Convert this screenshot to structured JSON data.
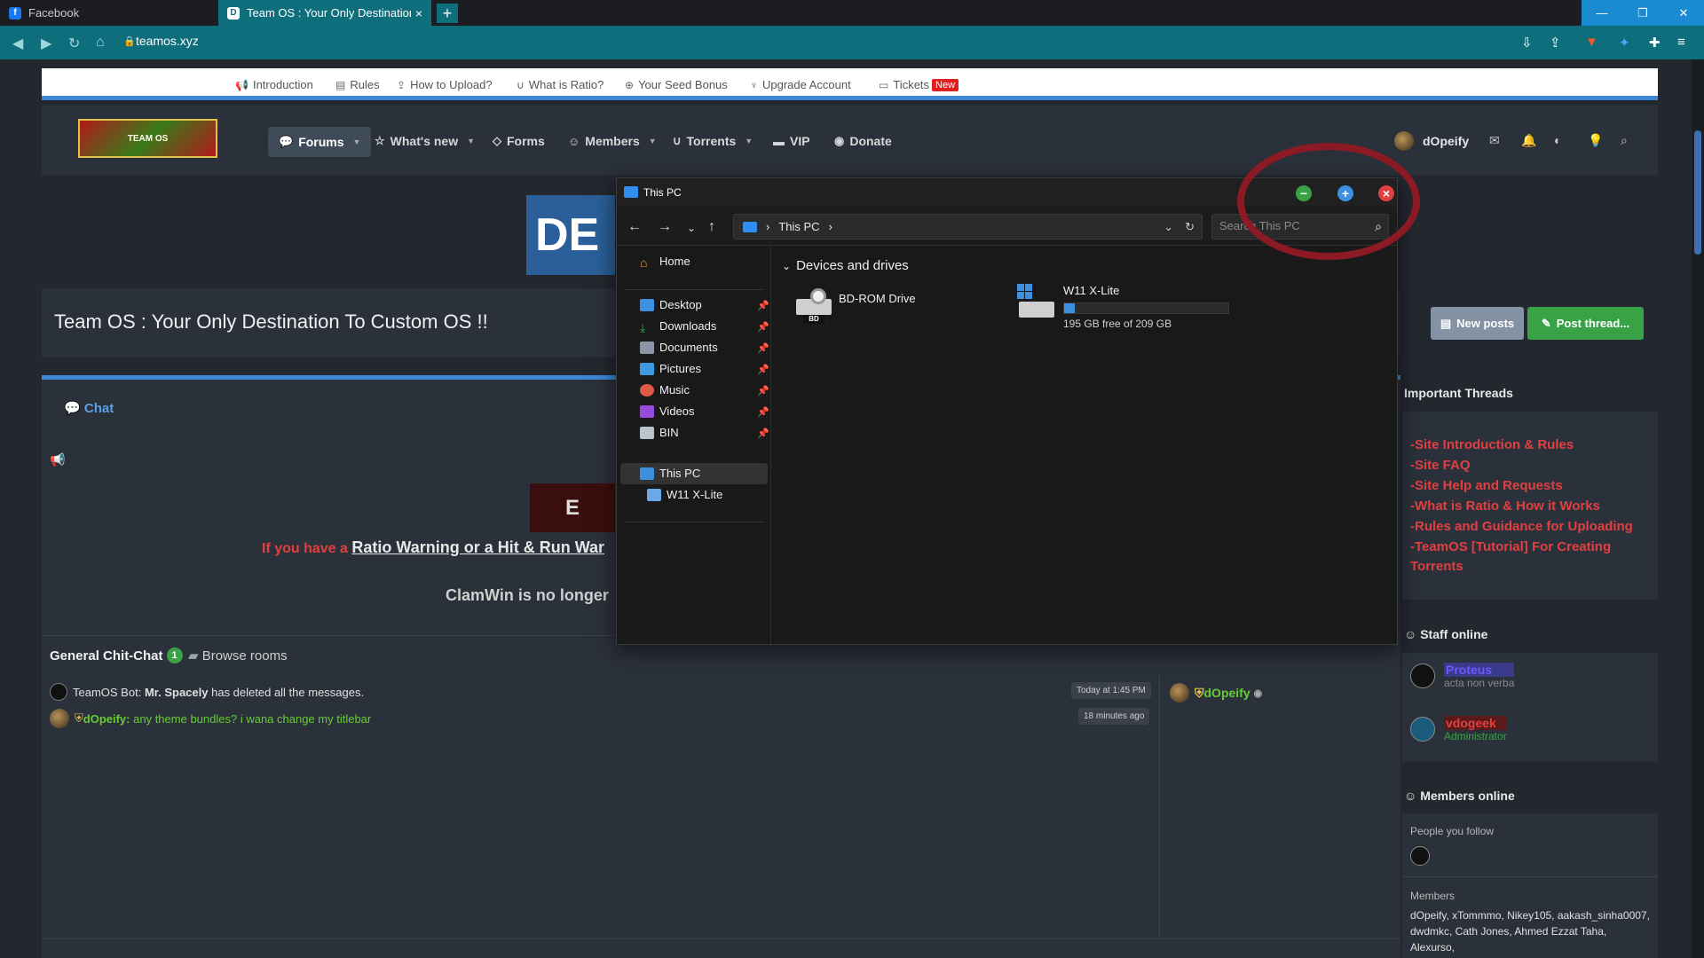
{
  "browser": {
    "tabs": [
      {
        "label": "Facebook"
      },
      {
        "label": "Team OS : Your Only Destination T"
      }
    ],
    "url": "teamos.xyz"
  },
  "site": {
    "top_links": [
      "Introduction",
      "Rules",
      "How to Upload?",
      "What is Ratio?",
      "Your Seed Bonus",
      "Upgrade Account",
      "Tickets"
    ],
    "new_badge": "New",
    "nav": [
      "Forums",
      "What's new",
      "Forms",
      "Members",
      "Torrents",
      "VIP",
      "Donate"
    ],
    "username": "dOpeify",
    "page_title": "Team OS : Your Only Destination To Custom OS !!",
    "new_posts": "New posts",
    "post_thread": "Post thread...",
    "chat_label": "Chat",
    "warn_prefix": "If you have a",
    "warn_link": "Ratio Warning or a Hit & Run War",
    "clam_text": "ClamWin is no longer",
    "room_name": "General Chit-Chat",
    "room_count": "1",
    "browse_rooms": "Browse rooms",
    "messages": [
      {
        "author": "TeamOS Bot:",
        "strong": "Mr. Spacely",
        "text": "has deleted all the messages.",
        "time": "Today at 1:45 PM"
      },
      {
        "author": "dOpeify:",
        "text": "any theme bundles? i wana change my titlebar",
        "time": "18 minutes ago"
      }
    ],
    "chat_user": "dOpeify"
  },
  "sidebar": {
    "important_title": "Important Threads",
    "threads": [
      "-Site Introduction & Rules",
      "-Site FAQ",
      "-Site Help and Requests",
      "-What is Ratio & How it Works",
      "-Rules and Guidance for Uploading",
      "-TeamOS [Tutorial] For Creating",
      "Torrents"
    ],
    "staff_title": "Staff online",
    "staff": [
      {
        "name": "Proteus",
        "sub": "acta non verba"
      },
      {
        "name": "vdogeek",
        "sub": "Administrator"
      }
    ],
    "members_title": "Members online",
    "people_follow": "People you follow",
    "members_label": "Members",
    "members_list": "dOpeify, xTommmo, Nikey105, aakash_sinha0007, dwdmkc, Cath Jones, Ahmed Ezzat Taha, Alexurso,"
  },
  "explorer": {
    "title": "This PC",
    "address": "This PC",
    "search_placeholder": "Search This PC",
    "sidebar": [
      {
        "label": "Home"
      },
      {
        "label": "Desktop"
      },
      {
        "label": "Downloads"
      },
      {
        "label": "Documents"
      },
      {
        "label": "Pictures"
      },
      {
        "label": "Music"
      },
      {
        "label": "Videos"
      },
      {
        "label": "BIN"
      },
      {
        "label": "This PC"
      },
      {
        "label": "W11 X-Lite"
      }
    ],
    "group": "Devices and drives",
    "drives": [
      {
        "name": "BD-ROM Drive",
        "sublabel": "BD"
      },
      {
        "name": "W11 X-Lite",
        "free": "195 GB free of 209 GB",
        "used_fraction": 0.067
      }
    ]
  },
  "colors": {
    "accent": "#3f87d6",
    "warn": "#e04040",
    "online": "#66cc33"
  }
}
